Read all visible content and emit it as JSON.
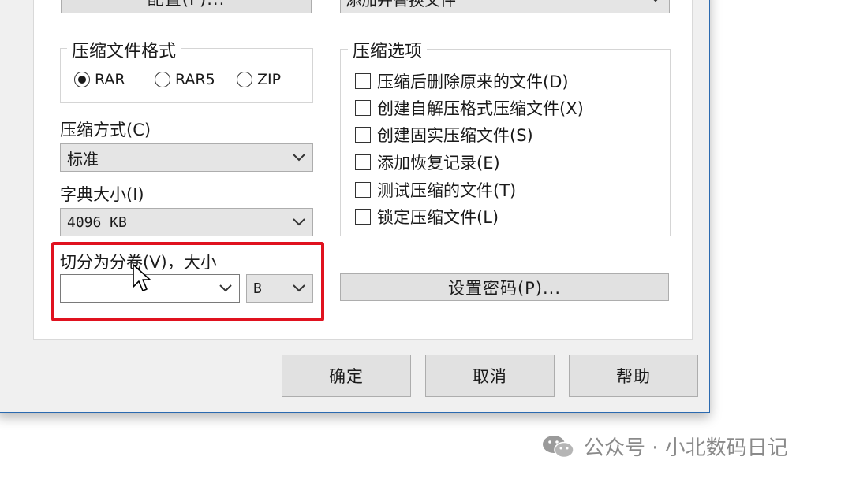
{
  "top": {
    "profile_button": "配置(F)...",
    "update_mode_value": "添加并替换文件"
  },
  "archive_format": {
    "legend": "压缩文件格式",
    "options": [
      {
        "label": "RAR",
        "selected": true
      },
      {
        "label": "RAR5",
        "selected": false
      },
      {
        "label": "ZIP",
        "selected": false
      }
    ]
  },
  "compression_method": {
    "label": "压缩方式(C)",
    "value": "标准"
  },
  "dictionary_size": {
    "label": "字典大小(I)",
    "value": "4096 KB"
  },
  "split_volumes": {
    "label": "切分为分卷(V)，大小",
    "size_value": "",
    "unit_value": "B"
  },
  "archive_options": {
    "legend": "压缩选项",
    "items": [
      {
        "label": "压缩后删除原来的文件(D)",
        "checked": false
      },
      {
        "label": "创建自解压格式压缩文件(X)",
        "checked": false
      },
      {
        "label": "创建固实压缩文件(S)",
        "checked": false
      },
      {
        "label": "添加恢复记录(E)",
        "checked": false
      },
      {
        "label": "测试压缩的文件(T)",
        "checked": false
      },
      {
        "label": "锁定压缩文件(L)",
        "checked": false
      }
    ]
  },
  "set_password_button": "设置密码(P)...",
  "footer": {
    "ok": "确定",
    "cancel": "取消",
    "help": "帮助"
  },
  "watermark": "公众号 · 小北数码日记",
  "colors": {
    "highlight": "#e0121f",
    "dialog_border": "#2b6ab0",
    "button_face": "#e1e1e1"
  }
}
